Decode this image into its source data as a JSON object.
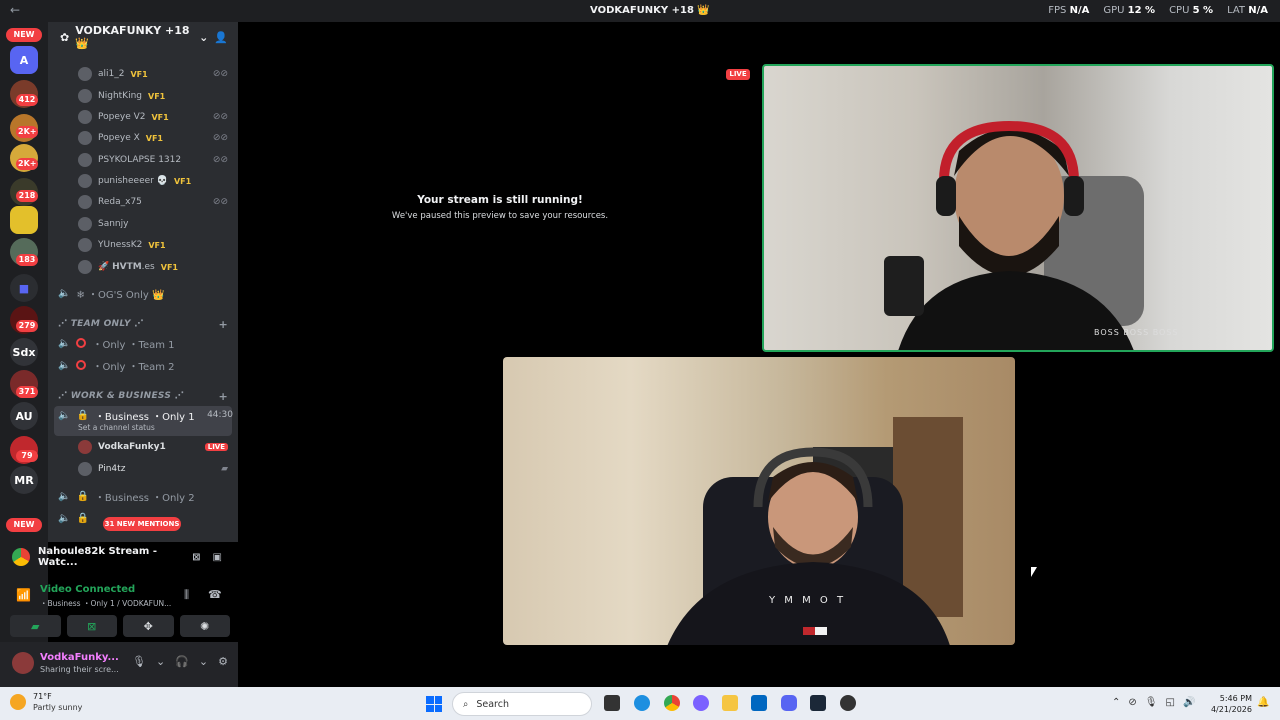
{
  "titlebar": {
    "title": "VODKAFUNKY +18 👑",
    "fps_label": "FPS",
    "fps_value": "N/A",
    "gpu_label": "GPU",
    "gpu_value": "12 %",
    "cpu_label": "CPU",
    "cpu_value": "5 %",
    "lat_label": "LAT",
    "lat_value": "N/A"
  },
  "servers": {
    "new_top": "NEW",
    "new_bottom": "NEW",
    "badges": [
      "412",
      "2K+",
      "2K+",
      "218",
      "183",
      "279",
      "371",
      "79"
    ],
    "text_icons": [
      "Sdx",
      "AU",
      "MR"
    ]
  },
  "guild": {
    "name": "VODKAFUNKY +18 👑"
  },
  "members": [
    {
      "name": "ali1_2",
      "tag": "VF1"
    },
    {
      "name": "NightKing",
      "tag": "VF1"
    },
    {
      "name": "Popeye V2",
      "tag": "VF1"
    },
    {
      "name": "Popeye X",
      "tag": "VF1"
    },
    {
      "name": "PSYKOLAPSE 1312",
      "tag": ""
    },
    {
      "name": "punisheeeer 💀",
      "tag": "VF1"
    },
    {
      "name": "Reda_x75",
      "tag": ""
    },
    {
      "name": "Sannjy",
      "tag": ""
    },
    {
      "name": "YUnessK2",
      "tag": "VF1"
    },
    {
      "name": "🚀 𝗛𝗩𝗧𝗠.es",
      "tag": "VF1"
    }
  ],
  "channels": {
    "ogs": "❄ ・OG'S Only 👑",
    "cat_team": "⋰ TEAM ONLY ⋰",
    "team1": "・Only ・Team 1",
    "team2": "・Only ・Team 2",
    "cat_work": "⋰ WORK & BUSINESS ⋰",
    "business1": "・Business ・Only 1",
    "business1_time": "44:30",
    "business1_status": "Set a channel status",
    "voice_user1": "VodkaFunky1",
    "voice_user1_live": "LIVE",
    "voice_user2": "Pin4tz",
    "business2": "・Business ・Only 2",
    "mentions": "31 NEW MENTIONS"
  },
  "stream_panel": {
    "title": "Nahoule82k Stream - Watc...",
    "voice_status": "Video Connected",
    "voice_location": "・Business ・Only 1 / VODKAFUN..."
  },
  "user": {
    "name": "VodkaFunky...",
    "status": "Sharing their scre..."
  },
  "stage": {
    "paused_title": "Your stream is still running!",
    "paused_sub": "We've paused this preview to save your resources.",
    "live_tag": "LIVE",
    "cam1_shirt": "BOSS BOSS BOSS",
    "cam2_shirt": "Y M M O T"
  },
  "taskbar": {
    "temp": "71°F",
    "condition": "Partly sunny",
    "search_placeholder": "Search",
    "time": "5:46 PM",
    "date": "4/21/2026"
  }
}
